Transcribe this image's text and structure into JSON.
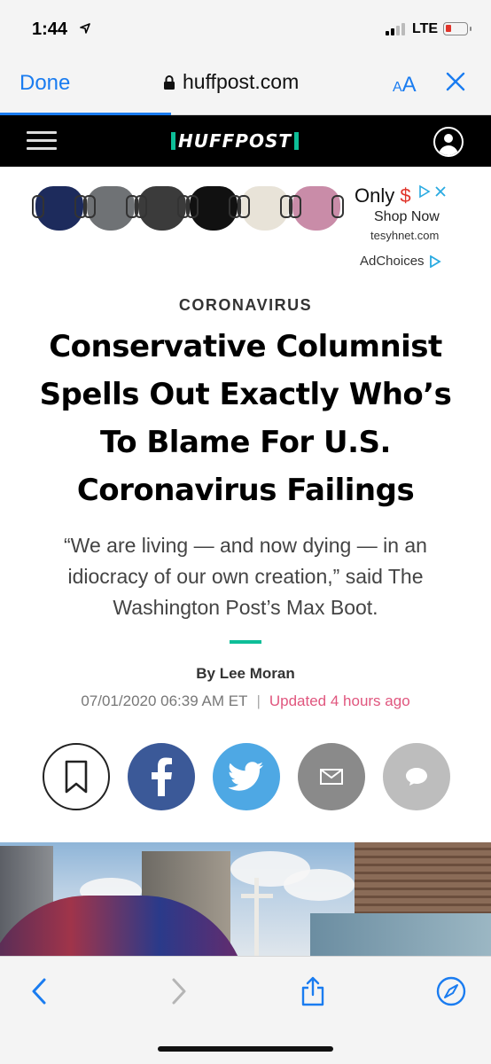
{
  "status_bar": {
    "time": "1:44",
    "network": "LTE"
  },
  "safari": {
    "done_label": "Done",
    "url": "huffpost.com",
    "text_size_small": "A",
    "text_size_large": "A"
  },
  "header": {
    "logo_text": "HUFFPOST"
  },
  "ad": {
    "headline": "Only",
    "price": "$",
    "cta": "Shop Now",
    "domain": "tesyhnet.com",
    "adchoices": "AdChoices",
    "mask_colors": [
      "#1d2b5c",
      "#6f7275",
      "#3b3b3b",
      "#111111",
      "#e8e3d8",
      "#c98ca8"
    ]
  },
  "article": {
    "kicker": "CORONAVIRUS",
    "headline": "Conservative Columnist Spells Out Exactly Who’s To Blame For U.S. Coronavirus Failings",
    "dek": "“We are living — and now dying — in an idiocracy of our own creation,” said The Washington Post’s Max Boot.",
    "byline": "By Lee Moran",
    "date": "07/01/2020 06:39 AM ET",
    "separator": "|",
    "updated": "Updated 4 hours ago"
  },
  "colors": {
    "accent": "#1a7cf0",
    "brand_green": "#0dbe98",
    "facebook": "#3b5998",
    "twitter": "#4ea8e4",
    "updated_pink": "#e0567e"
  }
}
